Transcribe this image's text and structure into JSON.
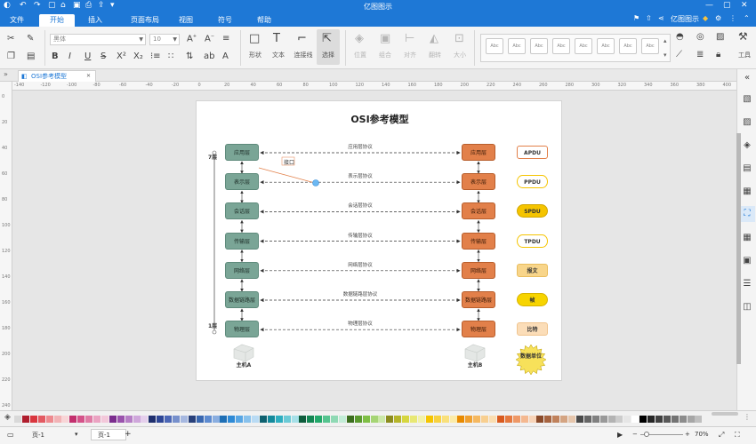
{
  "app": {
    "title": "亿图图示"
  },
  "menu": {
    "file": "文件",
    "start": "开始",
    "insert": "插入",
    "page_layout": "页面布局",
    "view": "视图",
    "symbol": "符号",
    "help": "帮助",
    "account": "亿图图示"
  },
  "ribbon": {
    "font_name": "黑体",
    "font_size": "10",
    "shape": "形状",
    "text": "文本",
    "connector": "连接线",
    "select": "选择",
    "position": "位置",
    "group": "组合",
    "align": "对齐",
    "flip": "翻转",
    "size": "大小",
    "tools": "工具",
    "style_sample": "Abc"
  },
  "tab": {
    "label": "OSI参考模型"
  },
  "ruler": {
    "h_ticks": [
      "-140",
      "-120",
      "-100",
      "-80",
      "-60",
      "-40",
      "-20",
      "0",
      "20",
      "40",
      "60",
      "80",
      "100",
      "120",
      "140",
      "160",
      "180",
      "200",
      "220",
      "240",
      "260",
      "280",
      "300",
      "320",
      "340",
      "360",
      "380",
      "400"
    ],
    "v_ticks": [
      "0",
      "20",
      "40",
      "60",
      "80",
      "100",
      "120",
      "140",
      "160",
      "180",
      "200",
      "220",
      "240"
    ]
  },
  "diagram": {
    "title": "OSI参考模型",
    "label_top": "7层",
    "label_bottom": "1层",
    "interface": "接口",
    "hostA": "主机A",
    "hostB": "主机B",
    "layers": [
      "应用层",
      "表示层",
      "会话层",
      "传输层",
      "网络层",
      "数据链路层",
      "物理层"
    ],
    "protocols": [
      "应用层协议",
      "表示层协议",
      "会话层协议",
      "传输层协议",
      "网络层协议",
      "数据链路层协议",
      "物理层协议"
    ],
    "units": [
      "APDU",
      "PPDU",
      "SPDU",
      "TPDU",
      "报文",
      "帧",
      "比特"
    ],
    "data_unit": "数据单位"
  },
  "colors": {
    "accent": "#1e78d6",
    "layer_a": "#7aa596",
    "layer_b": "#e2804a",
    "palette": [
      "#d9d9d9",
      "#b01e2e",
      "#d9363e",
      "#e35a62",
      "#ee8a8f",
      "#f2b3b6",
      "#f8d5d7",
      "#c3306e",
      "#d5538a",
      "#e07ba5",
      "#eba3c2",
      "#f3c8da",
      "#7b2d8e",
      "#9a53ad",
      "#b67ec6",
      "#cfa7db",
      "#e5cfec",
      "#1f2f6e",
      "#2e4696",
      "#4c67b6",
      "#7790cc",
      "#a6b8e0",
      "#28407a",
      "#3967b0",
      "#5d8bd0",
      "#8aaee0",
      "#1e6fb5",
      "#2e8ad6",
      "#58a6e4",
      "#88c1ec",
      "#b9dbf4",
      "#0e6170",
      "#148a9c",
      "#2eaec0",
      "#6ccad6",
      "#a6e0e8",
      "#0d5c3c",
      "#138653",
      "#22a86a",
      "#55c48f",
      "#8fd9b4",
      "#c2ecd6",
      "#3c6e1e",
      "#5a9a2e",
      "#7fbf45",
      "#a6d575",
      "#cbe8a8",
      "#8c8c1e",
      "#b5b52a",
      "#d6d640",
      "#e8e874",
      "#f2f2a8",
      "#f5c400",
      "#f7d240",
      "#f9e07a",
      "#fbeba8",
      "#e88a00",
      "#f0a030",
      "#f5b860",
      "#f8cf90",
      "#faddb0",
      "#d95a1e",
      "#e5783e",
      "#ee9866",
      "#f4b890",
      "#f8d4b8",
      "#8a4a2a",
      "#a66440",
      "#c0825c",
      "#d4a482",
      "#e6c6ac",
      "#4a4a4a",
      "#666666",
      "#808080",
      "#999999",
      "#b3b3b3",
      "#cccccc",
      "#e6e6e6",
      "#ffffff",
      "#000000",
      "#262626",
      "#404040",
      "#595959",
      "#737373",
      "#8c8c8c",
      "#a6a6a6",
      "#bfbfbf"
    ]
  },
  "status": {
    "page_select": "页-1",
    "page_tab": "页-1",
    "add": "+",
    "zoom": "70%"
  }
}
